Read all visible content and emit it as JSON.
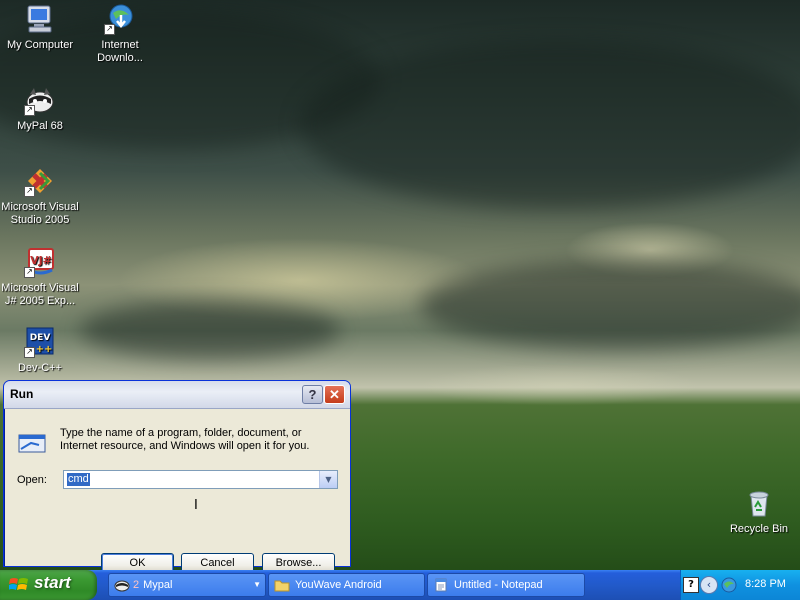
{
  "desktop": {
    "icons": [
      {
        "label": "My Computer",
        "icon": "my-computer-icon"
      },
      {
        "label": "Internet Downlo...",
        "icon": "internet-download-manager-icon"
      },
      {
        "label": "MyPal 68",
        "icon": "mypal-icon"
      },
      {
        "label": "Microsoft Visual Studio 2005",
        "icon": "visual-studio-icon"
      },
      {
        "label": "Microsoft Visual J# 2005 Exp...",
        "icon": "visual-jsharp-icon"
      },
      {
        "label": "Dev-C++",
        "icon": "dev-cpp-icon"
      },
      {
        "label": "Recycle Bin",
        "icon": "recycle-bin-icon"
      }
    ]
  },
  "run_dialog": {
    "title": "Run",
    "help_glyph": "?",
    "close_glyph": "✕",
    "description": "Type the name of a program, folder, document, or Internet resource, and Windows will open it for you.",
    "open_label": "Open:",
    "open_value": "cmd",
    "buttons": {
      "ok": "OK",
      "cancel": "Cancel",
      "browse": "Browse..."
    }
  },
  "taskbar": {
    "start_label": "start",
    "tasks": [
      {
        "label": "Mypal",
        "group_count": "2",
        "icon": "mypal-icon"
      },
      {
        "label": "YouWave Android",
        "icon": "folder-icon"
      },
      {
        "label": "Untitled - Notepad",
        "icon": "notepad-icon"
      }
    ],
    "tray": {
      "clock": "8:28 PM"
    }
  },
  "colors": {
    "xp_blue": "#245edb",
    "start_green": "#3c9a33",
    "tray_blue": "#0f91e0",
    "selection_blue": "#316ac5"
  }
}
